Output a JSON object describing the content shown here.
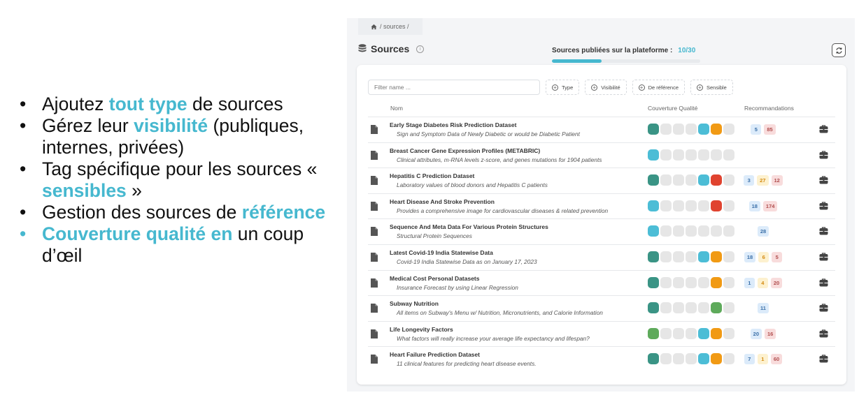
{
  "bullets": [
    {
      "parts": [
        {
          "t": "Ajoutez ",
          "hl": false
        },
        {
          "t": "tout type",
          "hl": true
        },
        {
          "t": " de sources",
          "hl": false
        }
      ],
      "accent": false
    },
    {
      "parts": [
        {
          "t": "Gérez leur ",
          "hl": false
        },
        {
          "t": "visibilité",
          "hl": true
        },
        {
          "t": " (publiques, internes, privées)",
          "hl": false
        }
      ],
      "accent": false
    },
    {
      "parts": [
        {
          "t": "Tag spécifique pour les sources « ",
          "hl": false
        },
        {
          "t": "sensibles",
          "hl": true
        },
        {
          "t": " »",
          "hl": false
        }
      ],
      "accent": false
    },
    {
      "parts": [
        {
          "t": "Gestion des sources de ",
          "hl": false
        },
        {
          "t": "référence",
          "hl": true
        }
      ],
      "accent": false
    },
    {
      "parts": [
        {
          "t": "Couverture qualité  en",
          "hl": true
        },
        {
          "t": " un coup d’œil",
          "hl": false
        }
      ],
      "accent": true
    }
  ],
  "breadcrumb": {
    "home_icon": "home-icon",
    "path": "/ sources /"
  },
  "header": {
    "title": "Sources",
    "title_icon": "database-icon",
    "info_icon": "info-icon",
    "published_label": "Sources publiées sur la plateforme :",
    "published_value": "10/30",
    "published_fraction": 0.3333,
    "refresh_icon": "refresh-icon"
  },
  "filters": {
    "search_placeholder": "Filter name ...",
    "buttons": [
      "Type",
      "Visibilité",
      "De référence",
      "Sensible"
    ]
  },
  "table": {
    "columns": {
      "name": "Nom",
      "coverage": "Couverture Qualité",
      "recommendations": "Recommandations"
    },
    "row_icon": "file-icon",
    "action_icon": "briefcase-icon",
    "rows": [
      {
        "name": "Early Stage Diabetes Risk Prediction Dataset",
        "desc": "Sign and Symptom Data of Newly Diabetic or would be Diabetic Patient",
        "coverage": [
          "teal",
          "empty",
          "empty",
          "empty",
          "blue",
          "orange",
          "empty"
        ],
        "recs": [
          {
            "v": "5",
            "k": "info"
          },
          {
            "v": "85",
            "k": "danger"
          }
        ]
      },
      {
        "name": "Breast Cancer Gene Expression Profiles (METABRIC)",
        "desc": "Clinical attributes, m-RNA levels z-score, and genes mutations for 1904 patients",
        "coverage": [
          "blue",
          "empty",
          "empty",
          "empty",
          "empty",
          "empty",
          "empty"
        ],
        "recs": []
      },
      {
        "name": "Hepatitis C Prediction Dataset",
        "desc": "Laboratory values of blood donors and Hepatitis C patients",
        "coverage": [
          "teal",
          "empty",
          "empty",
          "empty",
          "blue",
          "red",
          "empty"
        ],
        "recs": [
          {
            "v": "3",
            "k": "info"
          },
          {
            "v": "27",
            "k": "warn"
          },
          {
            "v": "12",
            "k": "danger"
          }
        ]
      },
      {
        "name": "Heart Disease And Stroke Prevention",
        "desc": "Provides a comprehensive image for cardiovascular diseases & related prevention",
        "coverage": [
          "blue",
          "empty",
          "empty",
          "empty",
          "empty",
          "red",
          "empty"
        ],
        "recs": [
          {
            "v": "18",
            "k": "info"
          },
          {
            "v": "174",
            "k": "danger"
          }
        ]
      },
      {
        "name": "Sequence And Meta Data For Various Protein Structures",
        "desc": "Structural Protein Sequences",
        "coverage": [
          "blue",
          "empty",
          "empty",
          "empty",
          "empty",
          "empty",
          "empty"
        ],
        "recs": [
          {
            "v": "28",
            "k": "info"
          }
        ]
      },
      {
        "name": "Latest Covid-19 India Statewise Data",
        "desc": "Covid-19 India Statewise Data as on January 17, 2023",
        "coverage": [
          "teal",
          "empty",
          "empty",
          "empty",
          "blue",
          "orange",
          "empty"
        ],
        "recs": [
          {
            "v": "18",
            "k": "info"
          },
          {
            "v": "6",
            "k": "warn"
          },
          {
            "v": "5",
            "k": "danger"
          }
        ]
      },
      {
        "name": "Medical Cost Personal Datasets",
        "desc": "Insurance Forecast by using Linear Regression",
        "coverage": [
          "teal",
          "empty",
          "empty",
          "empty",
          "empty",
          "orange",
          "empty"
        ],
        "recs": [
          {
            "v": "1",
            "k": "info"
          },
          {
            "v": "4",
            "k": "warn"
          },
          {
            "v": "20",
            "k": "danger"
          }
        ]
      },
      {
        "name": "Subway Nutrition",
        "desc": "All items on Subway's Menu w/ Nutrition, Micronutrients, and Calorie Information",
        "coverage": [
          "teal",
          "empty",
          "empty",
          "empty",
          "empty",
          "green",
          "empty"
        ],
        "recs": [
          {
            "v": "11",
            "k": "info"
          }
        ]
      },
      {
        "name": "Life Longevity Factors",
        "desc": "What factors will really increase your average life expectancy and lifespan?",
        "coverage": [
          "green",
          "empty",
          "empty",
          "empty",
          "blue",
          "orange",
          "empty"
        ],
        "recs": [
          {
            "v": "20",
            "k": "info"
          },
          {
            "v": "16",
            "k": "danger"
          }
        ]
      },
      {
        "name": "Heart Failure Prediction Dataset",
        "desc": "11 clinical features for predicting heart disease events.",
        "coverage": [
          "teal",
          "empty",
          "empty",
          "empty",
          "blue",
          "orange",
          "empty"
        ],
        "recs": [
          {
            "v": "7",
            "k": "info"
          },
          {
            "v": "1",
            "k": "warn"
          },
          {
            "v": "60",
            "k": "danger"
          }
        ]
      }
    ]
  },
  "colors": {
    "accent": "#46b8cf",
    "teal": "#3a9485",
    "blue": "#4cbdd6",
    "orange": "#f19a14",
    "red": "#e0432f",
    "green": "#5eaa5b",
    "empty": "#e6e6e6"
  }
}
